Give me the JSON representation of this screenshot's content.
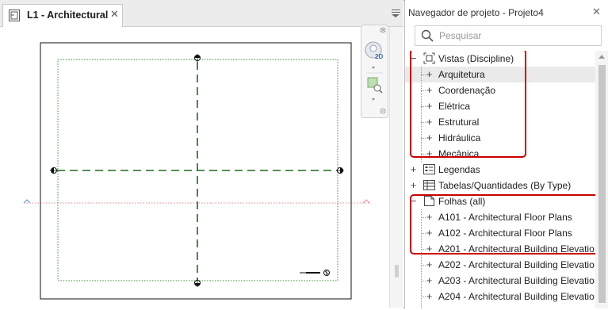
{
  "view": {
    "tab_label": "L1 - Architectural",
    "close_glyph": "✕",
    "nav_wheel_label": "2D"
  },
  "browser": {
    "title": "Navegador de projeto - Projeto4",
    "close_glyph": "✕",
    "search": {
      "placeholder": "Pesquisar",
      "value": ""
    },
    "tree": [
      {
        "label": "Vistas (Discipline)",
        "level": 0,
        "toggle": "−",
        "icon": "views-icon",
        "highlighted": false
      },
      {
        "label": "Arquitetura",
        "level": 1,
        "toggle": "+",
        "highlighted": true
      },
      {
        "label": "Coordenação",
        "level": 1,
        "toggle": "+",
        "highlighted": false
      },
      {
        "label": "Elétrica",
        "level": 1,
        "toggle": "+",
        "highlighted": false
      },
      {
        "label": "Estrutural",
        "level": 1,
        "toggle": "+",
        "highlighted": false
      },
      {
        "label": "Hidráulica",
        "level": 1,
        "toggle": "+",
        "highlighted": false
      },
      {
        "label": "Mecânica",
        "level": 1,
        "toggle": "+",
        "highlighted": false
      },
      {
        "label": "Legendas",
        "level": 0,
        "toggle": "+",
        "icon": "legend-icon",
        "highlighted": false
      },
      {
        "label": "Tabelas/Quantidades (By Type)",
        "level": 0,
        "toggle": "+",
        "icon": "schedule-icon",
        "highlighted": false
      },
      {
        "label": "Folhas (all)",
        "level": 0,
        "toggle": "−",
        "icon": "sheet-icon",
        "highlighted": false
      },
      {
        "label": "A101 - Architectural Floor Plans",
        "level": 1,
        "toggle": "+",
        "highlighted": false
      },
      {
        "label": "A102 - Architectural Floor Plans",
        "level": 1,
        "toggle": "+",
        "highlighted": false
      },
      {
        "label": "A201 - Architectural Building Elevatio",
        "level": 1,
        "toggle": "+",
        "highlighted": false
      },
      {
        "label": "A202 - Architectural Building Elevatio",
        "level": 1,
        "toggle": "+",
        "highlighted": false
      },
      {
        "label": "A203 - Architectural Building Elevatio",
        "level": 1,
        "toggle": "+",
        "highlighted": false
      },
      {
        "label": "A204 - Architectural Building Elevatio",
        "level": 1,
        "toggle": "+",
        "highlighted": false
      }
    ]
  },
  "colors": {
    "highlight_box": "#cc0000",
    "grid_line": "#1e6b1e",
    "crop_region": "#2e8b2e",
    "level_line": "#e88a8a",
    "level_marker": "#5b8fd6"
  }
}
